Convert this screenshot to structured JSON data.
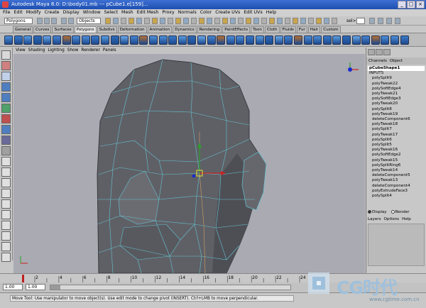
{
  "window": {
    "title": "Autodesk Maya 8.0: D:\\body01.mb    ---    pCube1.e[159]...",
    "buttons": [
      "_",
      "□",
      "×"
    ]
  },
  "menubar": [
    "File",
    "Edit",
    "Modify",
    "Create",
    "Display",
    "Window",
    "Select",
    "Mesh",
    "Edit Mesh",
    "Proxy",
    "Normals",
    "Color",
    "Create UVs",
    "Edit UVs",
    "Help"
  ],
  "statusline": {
    "mode": "Polygons",
    "selection_mask": "Objects",
    "sel_label": "sel>"
  },
  "shelf": {
    "tabs": [
      "General",
      "Curves",
      "Surfaces",
      "Polygons",
      "Subdivs",
      "Deformation",
      "Animation",
      "Dynamics",
      "Rendering",
      "PaintEffects",
      "Toon",
      "Cloth",
      "Fluids",
      "Fur",
      "Hair",
      "Custom"
    ],
    "active_tab": "Polygons",
    "icon_count": 42
  },
  "panel_menu": [
    "View",
    "Shading",
    "Lighting",
    "Show",
    "Renderer",
    "Panels"
  ],
  "channel_box": {
    "header": [
      "Channels",
      "Object"
    ],
    "node": "pCubeShape1",
    "inputs_label": "INPUTS",
    "items": [
      "polySplit9",
      "polyTweak22",
      "polySoftEdge4",
      "polyTweak21",
      "polySoftEdge3",
      "polyTweak20",
      "polySplit8",
      "polyTweak19",
      "deleteComponent6",
      "polyTweak18",
      "polySplit7",
      "polyTweak17",
      "polySplit6",
      "polySplit5",
      "polyTweak16",
      "polySoftEdge2",
      "polyTweak15",
      "polySplitRing6",
      "polyTweak14",
      "deleteComponent5",
      "polyTweak13",
      "deleteComponent4",
      "polyExtrudeFace3",
      "polySplit4"
    ]
  },
  "layer_editor": {
    "radio_display": "Display",
    "radio_render": "Render",
    "menu": [
      "Layers",
      "Options",
      "Help"
    ]
  },
  "time_slider": {
    "ticks": [
      "2",
      "4",
      "6",
      "8",
      "10",
      "12",
      "14",
      "16",
      "18",
      "20",
      "22",
      "24"
    ],
    "current": 1
  },
  "range_slider": {
    "start": "1.00",
    "end": "1.00"
  },
  "help_line": "Move Tool: Use manipulator to move object(s). Use edit mode to change pivot (INSERT). Ctrl+LMB to move perpendicular.",
  "watermark": {
    "text": "CG时代",
    "url": "www.cgtime.com.cn"
  },
  "colors": {
    "viewport_bg": "#a9aab2",
    "mesh": "#5f6066",
    "wire": "#65c4d2",
    "accent": "#1d4fb0"
  }
}
